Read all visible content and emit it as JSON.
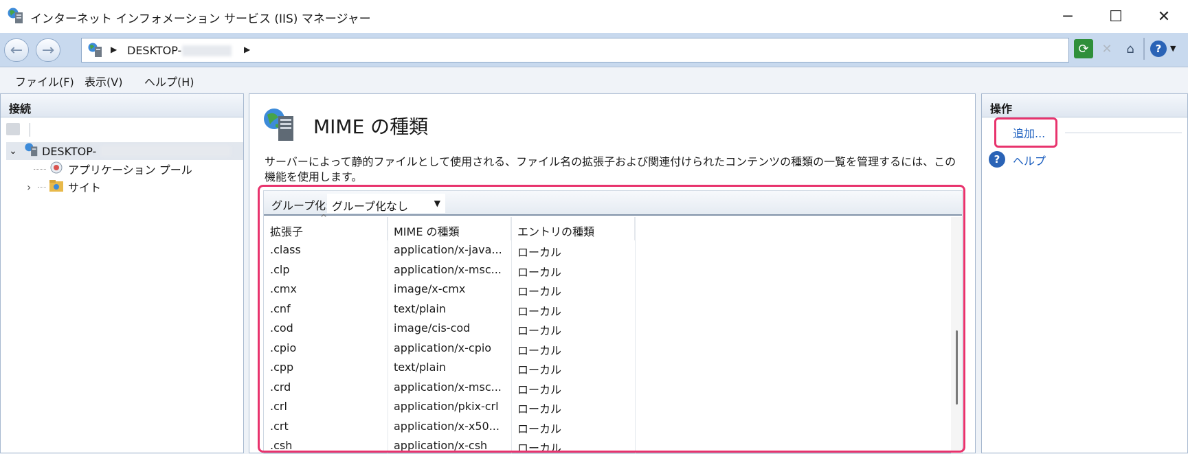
{
  "window": {
    "title": "インターネット インフォメーション サービス (IIS) マネージャー",
    "controls": [
      "─",
      "☐",
      "✕"
    ]
  },
  "address": {
    "breadcrumb": "DESKTOP-"
  },
  "menu": [
    "ファイル(F)",
    "表示(V)",
    "ヘルプ(H)"
  ],
  "connections": {
    "header": "接続",
    "tree": [
      {
        "label": "DESKTOP-",
        "expander": "⌄",
        "icon": "server-icon"
      },
      {
        "label": "アプリケーション プール",
        "icon": "app-pool-icon"
      },
      {
        "label": "サイト",
        "expander": "›",
        "icon": "sites-folder-icon"
      }
    ]
  },
  "center": {
    "title": "MIME の種類",
    "description": "サーバーによって静的ファイルとして使用される、ファイル名の拡張子および関連付けられたコンテンツの種類の一覧を管理するには、この機能を使用します。",
    "group_label": "グループ化:",
    "group_value": "グループ化なし",
    "columns": [
      "拡張子",
      "MIME の種類",
      "エントリの種類"
    ],
    "rows": [
      {
        "ext": ".class",
        "mime": "application/x-java...",
        "entry": "ローカル"
      },
      {
        "ext": ".clp",
        "mime": "application/x-msc...",
        "entry": "ローカル"
      },
      {
        "ext": ".cmx",
        "mime": "image/x-cmx",
        "entry": "ローカル"
      },
      {
        "ext": ".cnf",
        "mime": "text/plain",
        "entry": "ローカル"
      },
      {
        "ext": ".cod",
        "mime": "image/cis-cod",
        "entry": "ローカル"
      },
      {
        "ext": ".cpio",
        "mime": "application/x-cpio",
        "entry": "ローカル"
      },
      {
        "ext": ".cpp",
        "mime": "text/plain",
        "entry": "ローカル"
      },
      {
        "ext": ".crd",
        "mime": "application/x-msc...",
        "entry": "ローカル"
      },
      {
        "ext": ".crl",
        "mime": "application/pkix-crl",
        "entry": "ローカル"
      },
      {
        "ext": ".crt",
        "mime": "application/x-x50...",
        "entry": "ローカル"
      },
      {
        "ext": ".csh",
        "mime": "application/x-csh",
        "entry": "ローカル"
      }
    ]
  },
  "actions": {
    "header": "操作",
    "add": "追加...",
    "help": "ヘルプ"
  },
  "colors": {
    "highlight": "#e8336d",
    "link": "#1c5fbf"
  }
}
